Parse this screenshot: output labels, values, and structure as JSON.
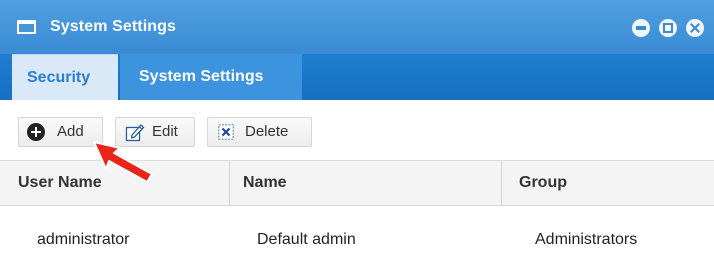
{
  "window": {
    "title": "System Settings",
    "controls": [
      "minimize",
      "restore",
      "close"
    ]
  },
  "tabs": [
    {
      "label": "Security",
      "active": true
    },
    {
      "label": "System Settings",
      "active": false
    }
  ],
  "toolbar": {
    "add_label": "Add",
    "edit_label": "Edit",
    "delete_label": "Delete"
  },
  "grid": {
    "columns": [
      "User Name",
      "Name",
      "Group"
    ],
    "rows": [
      {
        "user_name": "administrator",
        "name": "Default admin",
        "group": "Administrators"
      }
    ]
  },
  "icons": {
    "window": "window-icon",
    "add": "plus-circle-icon",
    "edit": "edit-icon",
    "delete": "delete-icon",
    "pointer": "red-arrow-icon"
  },
  "colors": {
    "titlebar": "#3a8bd4",
    "tabbar": "#1f7fd1",
    "active_tab_bg": "#d9e9f8",
    "active_tab_text": "#2a7fd0",
    "arrow": "#e8241b"
  }
}
